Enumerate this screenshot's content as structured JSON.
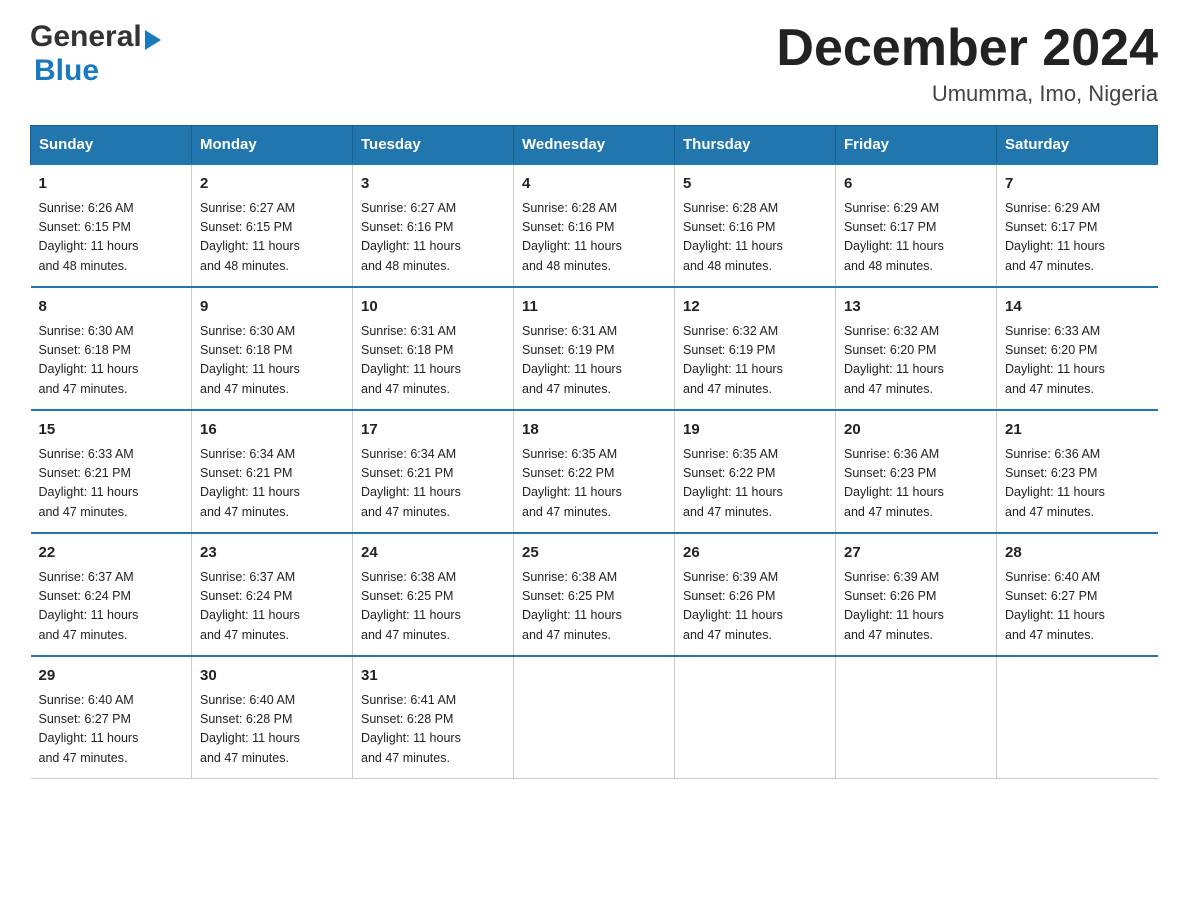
{
  "logo": {
    "general": "General",
    "blue": "Blue",
    "arrow": "▶"
  },
  "header": {
    "title": "December 2024",
    "subtitle": "Umumma, Imo, Nigeria"
  },
  "weekdays": [
    "Sunday",
    "Monday",
    "Tuesday",
    "Wednesday",
    "Thursday",
    "Friday",
    "Saturday"
  ],
  "weeks": [
    [
      {
        "day": "1",
        "sunrise": "6:26 AM",
        "sunset": "6:15 PM",
        "daylight": "11 hours and 48 minutes."
      },
      {
        "day": "2",
        "sunrise": "6:27 AM",
        "sunset": "6:15 PM",
        "daylight": "11 hours and 48 minutes."
      },
      {
        "day": "3",
        "sunrise": "6:27 AM",
        "sunset": "6:16 PM",
        "daylight": "11 hours and 48 minutes."
      },
      {
        "day": "4",
        "sunrise": "6:28 AM",
        "sunset": "6:16 PM",
        "daylight": "11 hours and 48 minutes."
      },
      {
        "day": "5",
        "sunrise": "6:28 AM",
        "sunset": "6:16 PM",
        "daylight": "11 hours and 48 minutes."
      },
      {
        "day": "6",
        "sunrise": "6:29 AM",
        "sunset": "6:17 PM",
        "daylight": "11 hours and 48 minutes."
      },
      {
        "day": "7",
        "sunrise": "6:29 AM",
        "sunset": "6:17 PM",
        "daylight": "11 hours and 47 minutes."
      }
    ],
    [
      {
        "day": "8",
        "sunrise": "6:30 AM",
        "sunset": "6:18 PM",
        "daylight": "11 hours and 47 minutes."
      },
      {
        "day": "9",
        "sunrise": "6:30 AM",
        "sunset": "6:18 PM",
        "daylight": "11 hours and 47 minutes."
      },
      {
        "day": "10",
        "sunrise": "6:31 AM",
        "sunset": "6:18 PM",
        "daylight": "11 hours and 47 minutes."
      },
      {
        "day": "11",
        "sunrise": "6:31 AM",
        "sunset": "6:19 PM",
        "daylight": "11 hours and 47 minutes."
      },
      {
        "day": "12",
        "sunrise": "6:32 AM",
        "sunset": "6:19 PM",
        "daylight": "11 hours and 47 minutes."
      },
      {
        "day": "13",
        "sunrise": "6:32 AM",
        "sunset": "6:20 PM",
        "daylight": "11 hours and 47 minutes."
      },
      {
        "day": "14",
        "sunrise": "6:33 AM",
        "sunset": "6:20 PM",
        "daylight": "11 hours and 47 minutes."
      }
    ],
    [
      {
        "day": "15",
        "sunrise": "6:33 AM",
        "sunset": "6:21 PM",
        "daylight": "11 hours and 47 minutes."
      },
      {
        "day": "16",
        "sunrise": "6:34 AM",
        "sunset": "6:21 PM",
        "daylight": "11 hours and 47 minutes."
      },
      {
        "day": "17",
        "sunrise": "6:34 AM",
        "sunset": "6:21 PM",
        "daylight": "11 hours and 47 minutes."
      },
      {
        "day": "18",
        "sunrise": "6:35 AM",
        "sunset": "6:22 PM",
        "daylight": "11 hours and 47 minutes."
      },
      {
        "day": "19",
        "sunrise": "6:35 AM",
        "sunset": "6:22 PM",
        "daylight": "11 hours and 47 minutes."
      },
      {
        "day": "20",
        "sunrise": "6:36 AM",
        "sunset": "6:23 PM",
        "daylight": "11 hours and 47 minutes."
      },
      {
        "day": "21",
        "sunrise": "6:36 AM",
        "sunset": "6:23 PM",
        "daylight": "11 hours and 47 minutes."
      }
    ],
    [
      {
        "day": "22",
        "sunrise": "6:37 AM",
        "sunset": "6:24 PM",
        "daylight": "11 hours and 47 minutes."
      },
      {
        "day": "23",
        "sunrise": "6:37 AM",
        "sunset": "6:24 PM",
        "daylight": "11 hours and 47 minutes."
      },
      {
        "day": "24",
        "sunrise": "6:38 AM",
        "sunset": "6:25 PM",
        "daylight": "11 hours and 47 minutes."
      },
      {
        "day": "25",
        "sunrise": "6:38 AM",
        "sunset": "6:25 PM",
        "daylight": "11 hours and 47 minutes."
      },
      {
        "day": "26",
        "sunrise": "6:39 AM",
        "sunset": "6:26 PM",
        "daylight": "11 hours and 47 minutes."
      },
      {
        "day": "27",
        "sunrise": "6:39 AM",
        "sunset": "6:26 PM",
        "daylight": "11 hours and 47 minutes."
      },
      {
        "day": "28",
        "sunrise": "6:40 AM",
        "sunset": "6:27 PM",
        "daylight": "11 hours and 47 minutes."
      }
    ],
    [
      {
        "day": "29",
        "sunrise": "6:40 AM",
        "sunset": "6:27 PM",
        "daylight": "11 hours and 47 minutes."
      },
      {
        "day": "30",
        "sunrise": "6:40 AM",
        "sunset": "6:28 PM",
        "daylight": "11 hours and 47 minutes."
      },
      {
        "day": "31",
        "sunrise": "6:41 AM",
        "sunset": "6:28 PM",
        "daylight": "11 hours and 47 minutes."
      },
      {
        "day": "",
        "sunrise": "",
        "sunset": "",
        "daylight": ""
      },
      {
        "day": "",
        "sunrise": "",
        "sunset": "",
        "daylight": ""
      },
      {
        "day": "",
        "sunrise": "",
        "sunset": "",
        "daylight": ""
      },
      {
        "day": "",
        "sunrise": "",
        "sunset": "",
        "daylight": ""
      }
    ]
  ],
  "labels": {
    "sunrise": "Sunrise: ",
    "sunset": "Sunset: ",
    "daylight": "Daylight: "
  }
}
